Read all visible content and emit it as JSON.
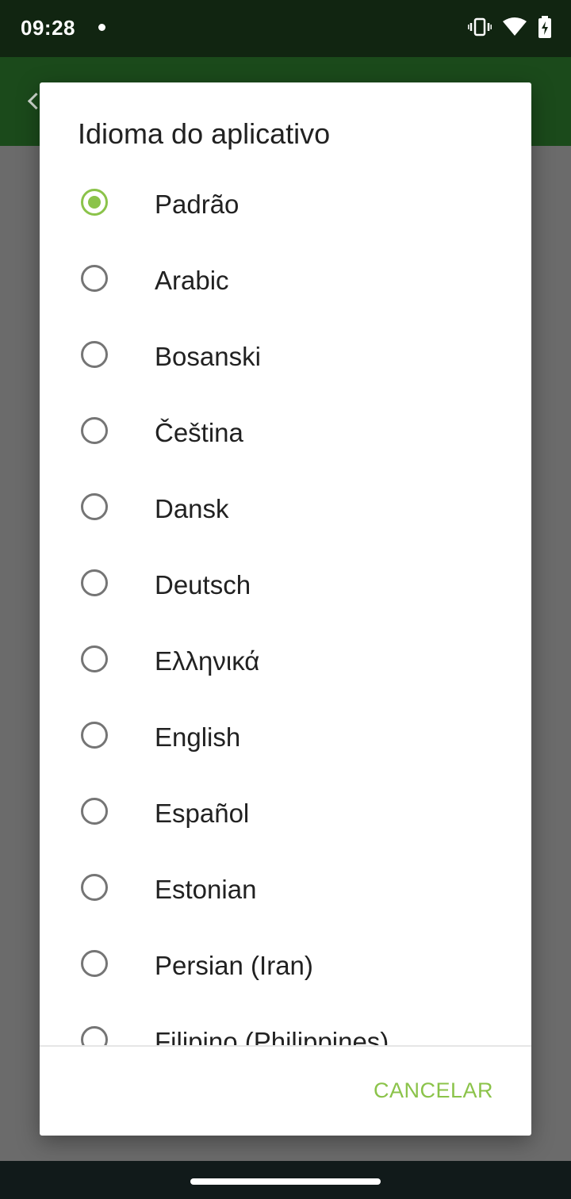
{
  "status": {
    "time": "09:28"
  },
  "dialog": {
    "title": "Idioma do aplicativo",
    "options": [
      {
        "label": "Padrão",
        "checked": true
      },
      {
        "label": "Arabic",
        "checked": false
      },
      {
        "label": "Bosanski",
        "checked": false
      },
      {
        "label": "Čeština",
        "checked": false
      },
      {
        "label": "Dansk",
        "checked": false
      },
      {
        "label": "Deutsch",
        "checked": false
      },
      {
        "label": "Ελληνικά",
        "checked": false
      },
      {
        "label": "English",
        "checked": false
      },
      {
        "label": "Español",
        "checked": false
      },
      {
        "label": "Estonian",
        "checked": false
      },
      {
        "label": "Persian (Iran)",
        "checked": false
      },
      {
        "label": "Filipino (Philippines)",
        "checked": false
      }
    ],
    "cancel_label": "CANCELAR"
  },
  "colors": {
    "accent": "#8bc34a",
    "statusbar": "#112511",
    "appbar": "#1b4a1b"
  },
  "icons": [
    "vibrate-icon",
    "wifi-icon",
    "battery-charging-icon"
  ]
}
